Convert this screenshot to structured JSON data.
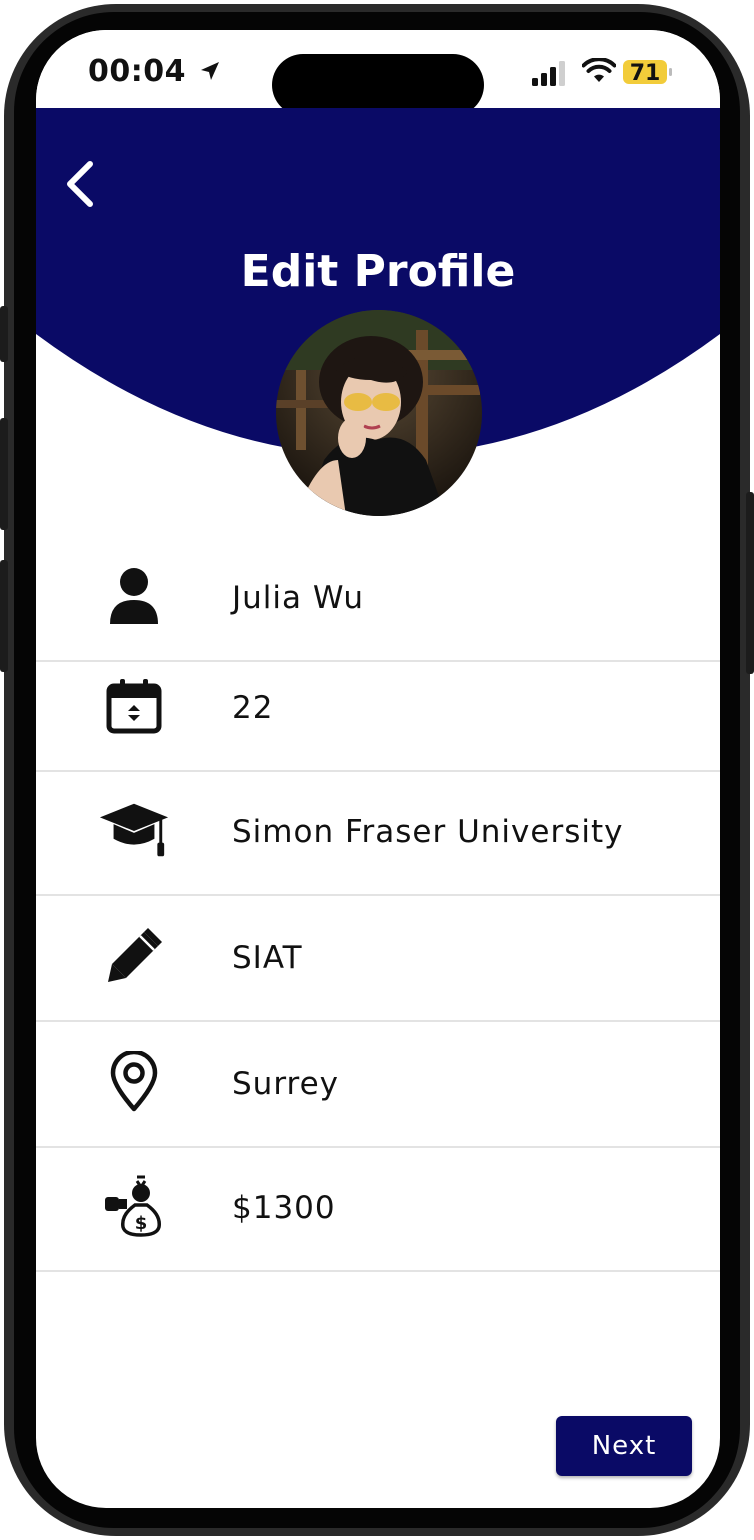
{
  "status_bar": {
    "time": "00:04",
    "battery_level": "71",
    "battery_color": "#f2cc3a"
  },
  "header": {
    "title": "Edit Profile",
    "background_color": "#0a0a66"
  },
  "profile_fields": [
    {
      "icon": "person-icon",
      "value": "Julia Wu"
    },
    {
      "icon": "calendar-icon",
      "value": "22"
    },
    {
      "icon": "graduation-cap-icon",
      "value": "Simon Fraser University"
    },
    {
      "icon": "pencil-icon",
      "value": "SIAT"
    },
    {
      "icon": "location-pin-icon",
      "value": "Surrey"
    },
    {
      "icon": "money-bag-icon",
      "value": "$1300"
    }
  ],
  "actions": {
    "next_label": "Next",
    "accent_color": "#0a0a66"
  }
}
